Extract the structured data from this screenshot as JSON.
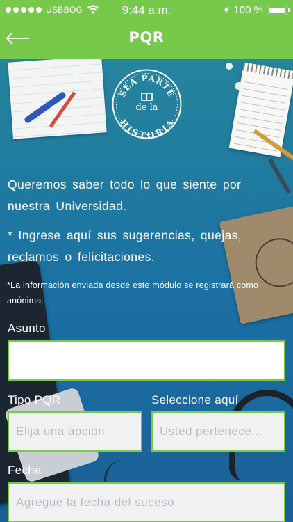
{
  "status_bar": {
    "carrier": "USBBOG",
    "time": "9:44 a.m.",
    "battery": "100 %"
  },
  "header": {
    "title": "PQR",
    "back_icon": "arrow-left-icon"
  },
  "logo": {
    "text_top": "SEA PARTE",
    "text_mid": "de la",
    "text_bottom": "HISTORIA"
  },
  "intro": {
    "line1": "Queremos saber todo lo que siente por nuestra Universidad.",
    "line2": "* Ingrese aquí sus sugerencias, quejas, reclamos o felicitaciones.",
    "note": "*La información enviada desde este módulo se registrará como anónima."
  },
  "form": {
    "asunto_label": "Asunto",
    "asunto_value": "",
    "tipo_label": "Tipo PQR",
    "tipo_placeholder": "Elija una apción",
    "seleccione_label": "Seleccione aquí",
    "seleccione_placeholder": "Usted pertenece...",
    "fecha_label": "Fecha",
    "fecha_placeholder": "Agregue la fecha del suceso"
  },
  "colors": {
    "header_green": "#76c94a",
    "field_border": "#78c94b"
  }
}
